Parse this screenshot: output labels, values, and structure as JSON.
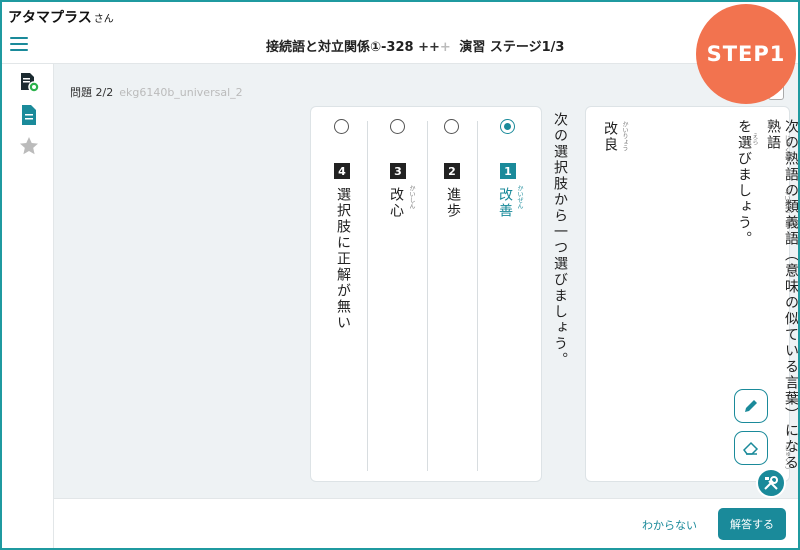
{
  "app": {
    "brand": "アタマプラス",
    "brand_suffix": "さん"
  },
  "header": {
    "title": "接続語と対立関係①-328",
    "plus_signs": [
      "+",
      "+",
      "+"
    ],
    "stage": "演習 ステージ1/3",
    "step_badge": "STEP1"
  },
  "sidebar": {
    "items": [
      "textbook-check-icon",
      "document-icon",
      "star-icon"
    ]
  },
  "problem": {
    "label": "問題 2/2",
    "id": "ekg6140b_universal_2"
  },
  "instruction": "次の選択肢から一つ選びましょう。",
  "choices": [
    {
      "num": "1",
      "text": "改善",
      "ruby": "かいぜん",
      "selected": true
    },
    {
      "num": "2",
      "text": "進歩",
      "ruby": "",
      "selected": false
    },
    {
      "num": "3",
      "text": "改心",
      "ruby": "かいしん",
      "selected": false
    },
    {
      "num": "4",
      "text": "選択肢に正解が無い",
      "ruby": "",
      "selected": false
    }
  ],
  "question": {
    "line1": "次の熟語の類義語（意味の似ている言葉）になる熟語",
    "line2": "を選びましょう。",
    "word": "改良",
    "word_ruby": "かいりょう",
    "ruby_jukugo": "じゅくご",
    "ruby_ruigigo": "るいぎご",
    "ruby_erabi": "えら",
    "ruby_jukugo2": "じゅくご"
  },
  "buttons": {
    "dont_know": "わからない",
    "submit": "解答する"
  },
  "colors": {
    "accent": "#1a8a9a",
    "badge": "#f2734f",
    "frame": "#1f9aa0"
  }
}
